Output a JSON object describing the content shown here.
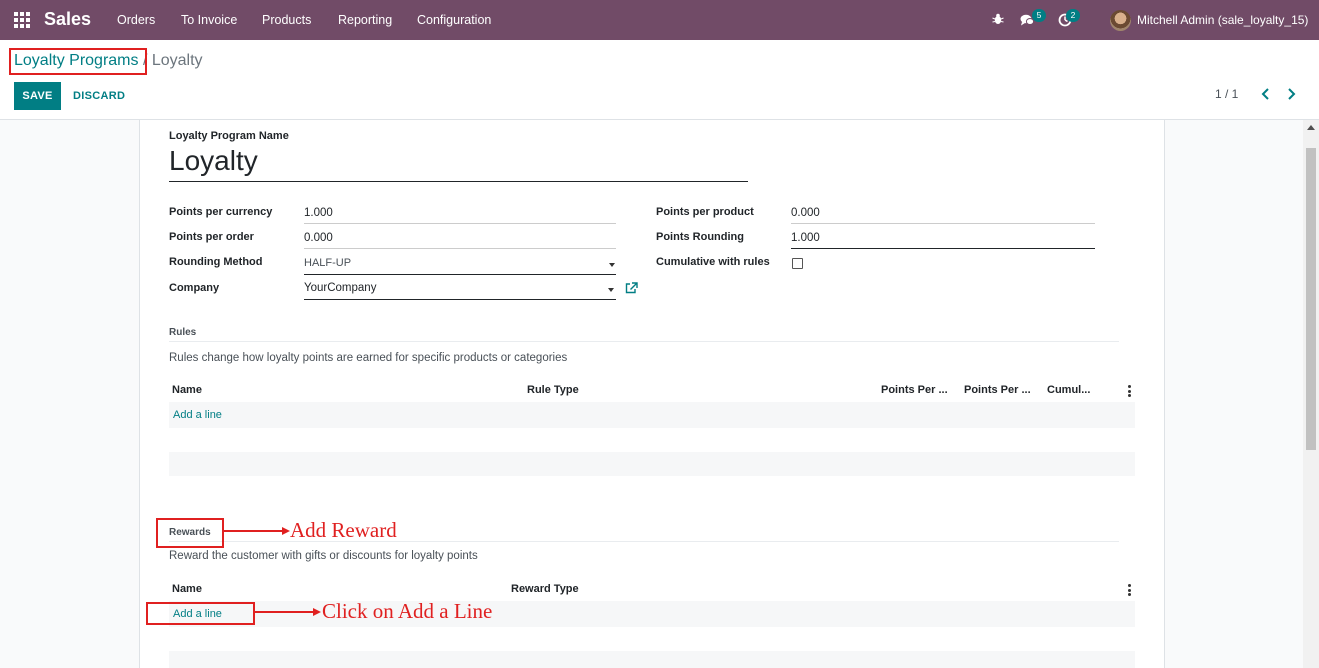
{
  "navbar": {
    "app_name": "Sales",
    "menu": [
      "Orders",
      "To Invoice",
      "Products",
      "Reporting",
      "Configuration"
    ],
    "messages_count": "5",
    "activities_count": "2",
    "user": "Mitchell Admin (sale_loyalty_15)"
  },
  "breadcrumb": {
    "parent": "Loyalty Programs",
    "separator": "/",
    "current": "Loyalty"
  },
  "buttons": {
    "save": "SAVE",
    "discard": "DISCARD"
  },
  "pager": {
    "value": "1 / 1"
  },
  "form": {
    "name_label": "Loyalty Program Name",
    "name_value": "Loyalty",
    "points_per_currency_label": "Points per currency",
    "points_per_currency_value": "1.000",
    "points_per_order_label": "Points per order",
    "points_per_order_value": "0.000",
    "rounding_method_label": "Rounding Method",
    "rounding_method_value": "HALF-UP",
    "company_label": "Company",
    "company_value": "YourCompany",
    "points_per_product_label": "Points per product",
    "points_per_product_value": "0.000",
    "points_rounding_label": "Points Rounding",
    "points_rounding_value": "1.000",
    "cumulative_label": "Cumulative with rules",
    "cumulative_checked": false
  },
  "rules": {
    "title": "Rules",
    "help": "Rules change how loyalty points are earned for specific products or categories",
    "columns": [
      "Name",
      "Rule Type",
      "Points Per ...",
      "Points Per ...",
      "Cumul..."
    ],
    "add_line": "Add a line"
  },
  "rewards": {
    "title": "Rewards",
    "help": "Reward the customer with gifts or discounts for loyalty points",
    "columns": [
      "Name",
      "Reward Type"
    ],
    "add_line": "Add a line"
  },
  "annotations": {
    "add_reward": "Add Reward",
    "click_add_line": "Click on Add a Line"
  },
  "colors": {
    "navbar": "#714b67",
    "primary": "#017e84",
    "annotation": "#e02020"
  }
}
